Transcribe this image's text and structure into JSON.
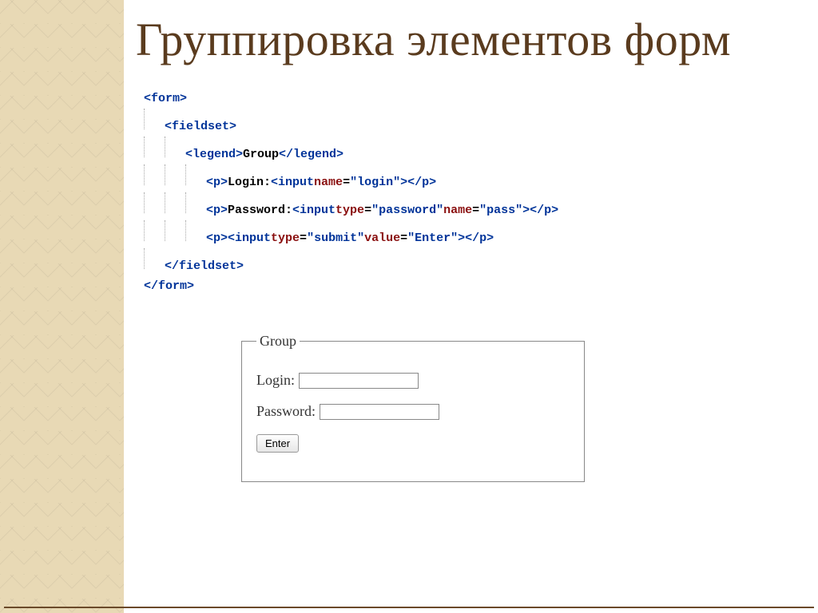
{
  "title": "Группировка элементов форм",
  "code": {
    "line1": {
      "open": "<form>"
    },
    "line2": {
      "open": "<fieldset>"
    },
    "line3": {
      "open": "<legend>",
      "text": "Group",
      "close": "</legend>"
    },
    "line4": {
      "p_open": "<p>",
      "text": "Login: ",
      "input_open": "<input ",
      "attr1": "name",
      "eq1": "=",
      "val1": "\"login\"",
      "input_close": ">",
      "p_close": "</p>"
    },
    "line5": {
      "p_open": "<p>",
      "text": "Password: ",
      "input_open": "<input ",
      "attr1": "type",
      "eq1": "=",
      "val1": "\"password\" ",
      "attr2": "name",
      "eq2": "=",
      "val2": "\"pass\"",
      "input_close": ">",
      "p_close": "</p>"
    },
    "line6": {
      "p_open": "<p>",
      "input_open": "<input ",
      "attr1": "type",
      "eq1": "=",
      "val1": "\"submit\" ",
      "attr2": "value",
      "eq2": "=",
      "val2": "\"Enter\"",
      "input_close": ">",
      "p_close": "</p>"
    },
    "line7": {
      "close": "</fieldset>"
    },
    "line8": {
      "close": "</form>"
    }
  },
  "form": {
    "legend": "Group",
    "login_label": "Login: ",
    "password_label": "Password: ",
    "submit_value": "Enter"
  }
}
